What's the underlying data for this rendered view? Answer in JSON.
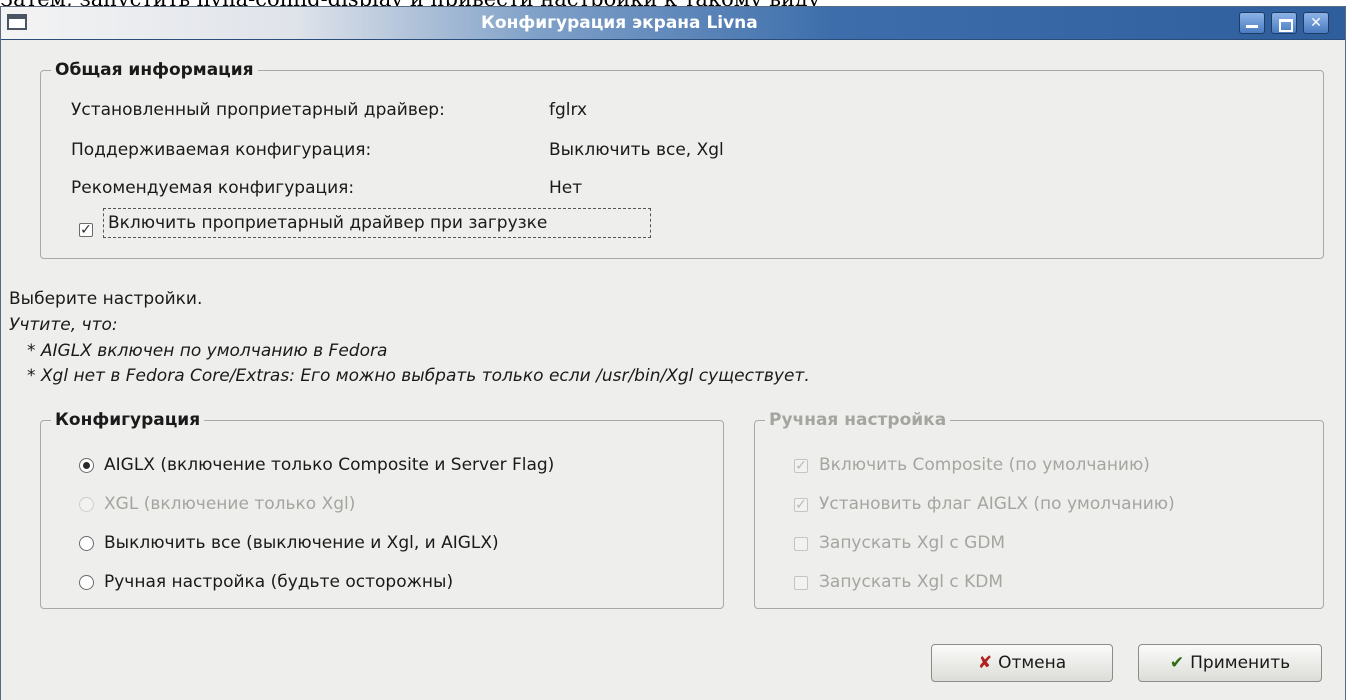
{
  "page_caption": "Затем, запустить livna-config-display и привести настройки к такому виду",
  "window": {
    "title": "Конфигурация экрана Livna"
  },
  "general_info": {
    "title": "Общая информация",
    "rows": [
      {
        "label": "Установленный проприетарный драйвер:",
        "value": "fglrx"
      },
      {
        "label": "Поддерживаемая конфигурация:",
        "value": "Выключить все, Xgl"
      },
      {
        "label": "Рекомендуемая конфигурация:",
        "value": "Нет"
      }
    ],
    "enable_driver": {
      "label": "Включить проприетарный драйвер при загрузке",
      "checked": true
    }
  },
  "notes": {
    "choose": "Выберите настройки.",
    "note_title": "Учтите, что:",
    "items": [
      "* AIGLX включен по умолчанию в Fedora",
      "* Xgl нет в Fedora Core/Extras: Его можно выбрать только если /usr/bin/Xgl существует."
    ]
  },
  "configuration": {
    "title": "Конфигурация",
    "options": [
      {
        "label": "AIGLX (включение только Composite и Server Flag)",
        "selected": true,
        "enabled": true
      },
      {
        "label": "XGL (включение только Xgl)",
        "selected": false,
        "enabled": false
      },
      {
        "label": "Выключить все (выключение и Xgl, и AIGLX)",
        "selected": false,
        "enabled": true
      },
      {
        "label": "Ручная настройка (будьте осторожны)",
        "selected": false,
        "enabled": true
      }
    ]
  },
  "manual": {
    "title": "Ручная настройка",
    "enabled": false,
    "options": [
      {
        "label": "Включить Composite (по умолчанию)",
        "checked": true
      },
      {
        "label": "Установить флаг AIGLX (по умолчанию)",
        "checked": true
      },
      {
        "label": "Запускать Xgl с GDM",
        "checked": false
      },
      {
        "label": "Запускать Xgl с KDM",
        "checked": false
      }
    ]
  },
  "buttons": {
    "cancel": "Отмена",
    "apply": "Применить"
  },
  "icons": {
    "cancel": "cross-icon",
    "apply": "checkmark-icon",
    "window_menu": "window-menu-icon"
  }
}
